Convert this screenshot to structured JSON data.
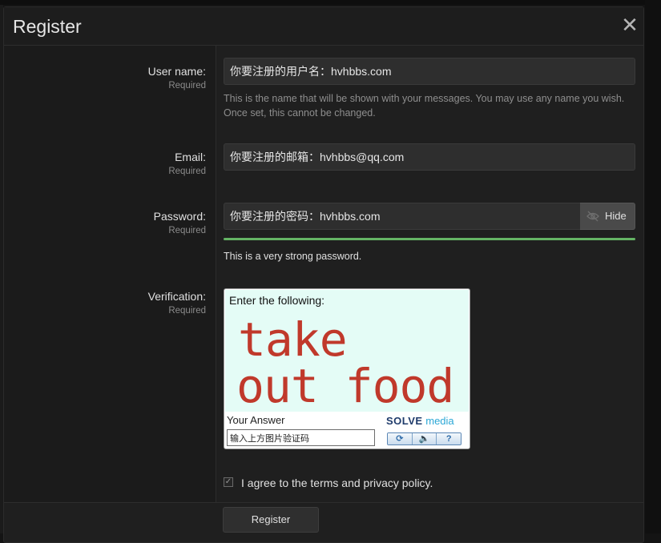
{
  "modal": {
    "title": "Register",
    "close_symbol": "✕"
  },
  "fields": {
    "username": {
      "label": "User name:",
      "required": "Required",
      "value": "你要注册的用户名：hvhbbs.com",
      "hint": "This is the name that will be shown with your messages. You may use any name you wish. Once set, this cannot be changed."
    },
    "email": {
      "label": "Email:",
      "required": "Required",
      "value": "你要注册的邮箱：hvhbbs@qq.com"
    },
    "password": {
      "label": "Password:",
      "required": "Required",
      "value": "你要注册的密码：hvhbbs.com",
      "toggle_label": "Hide",
      "toggle_icon": "eye-slash-icon",
      "strength_text": "This is a very strong password.",
      "strength_color": "#64b464"
    },
    "verification": {
      "label": "Verification:",
      "required": "Required"
    }
  },
  "captcha": {
    "prompt": "Enter the following:",
    "word1": "take",
    "word2": "out food",
    "answer_label": "Your Answer",
    "answer_value": "输入上方图片验证码",
    "brand_solve": "SOLVE",
    "brand_media": "media",
    "buttons": [
      {
        "icon": "refresh-icon",
        "glyph": "⟳"
      },
      {
        "icon": "audio-icon",
        "glyph": "🔈"
      },
      {
        "icon": "help-icon",
        "glyph": "?"
      }
    ]
  },
  "agree": {
    "checked": true,
    "text": "I agree to the terms and privacy policy."
  },
  "submit": {
    "label": "Register"
  }
}
